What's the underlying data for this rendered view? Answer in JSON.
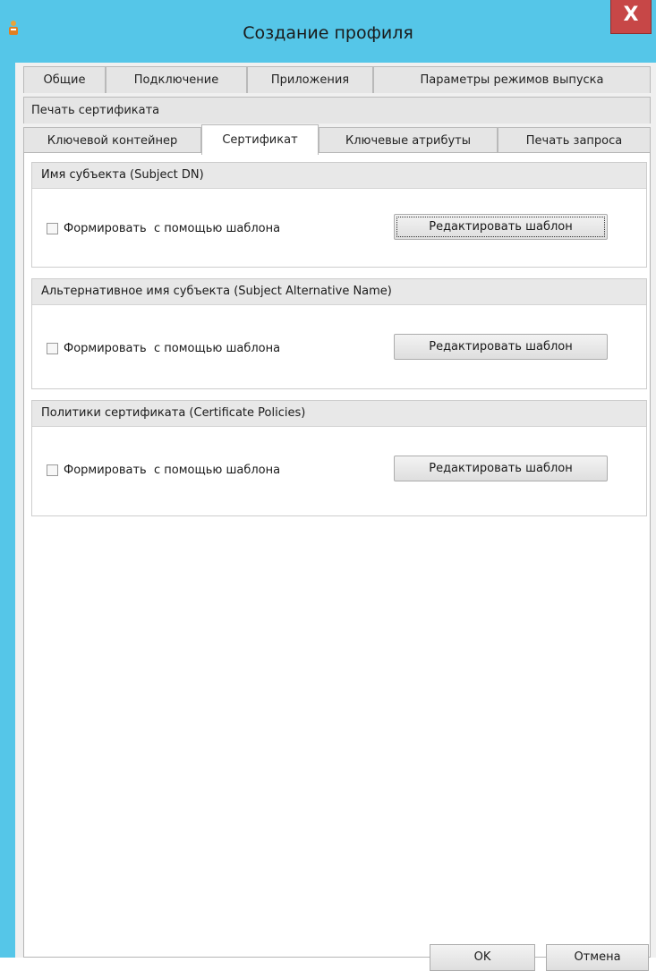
{
  "window": {
    "title": "Создание профиля",
    "close_label": "X",
    "accent_color": "#55c6e8"
  },
  "tabs": {
    "row1": [
      {
        "label": "Общие"
      },
      {
        "label": "Подключение"
      },
      {
        "label": "Приложения"
      },
      {
        "label": "Параметры режимов выпуска"
      }
    ],
    "row2": [
      {
        "label": "Печать сертификата"
      }
    ],
    "row3": [
      {
        "label": "Ключевой контейнер"
      },
      {
        "label": "Сертификат",
        "active": true
      },
      {
        "label": "Ключевые атрибуты"
      },
      {
        "label": "Печать запроса"
      }
    ]
  },
  "groups": [
    {
      "header": "Имя субъекта (Subject DN)",
      "checkbox_label": "Формировать  с помощью шаблона",
      "checked": false,
      "button_label": "Редактировать шаблон",
      "focused": true
    },
    {
      "header": "Альтернативное имя субъекта (Subject Alternative Name)",
      "checkbox_label": "Формировать  с помощью шаблона",
      "checked": false,
      "button_label": "Редактировать шаблон",
      "focused": false
    },
    {
      "header": "Политики сертификата (Certificate Policies)",
      "checkbox_label": "Формировать  с помощью шаблона",
      "checked": false,
      "button_label": "Редактировать шаблон",
      "focused": false
    }
  ],
  "footer": {
    "ok_label": "OK",
    "cancel_label": "Отмена"
  }
}
